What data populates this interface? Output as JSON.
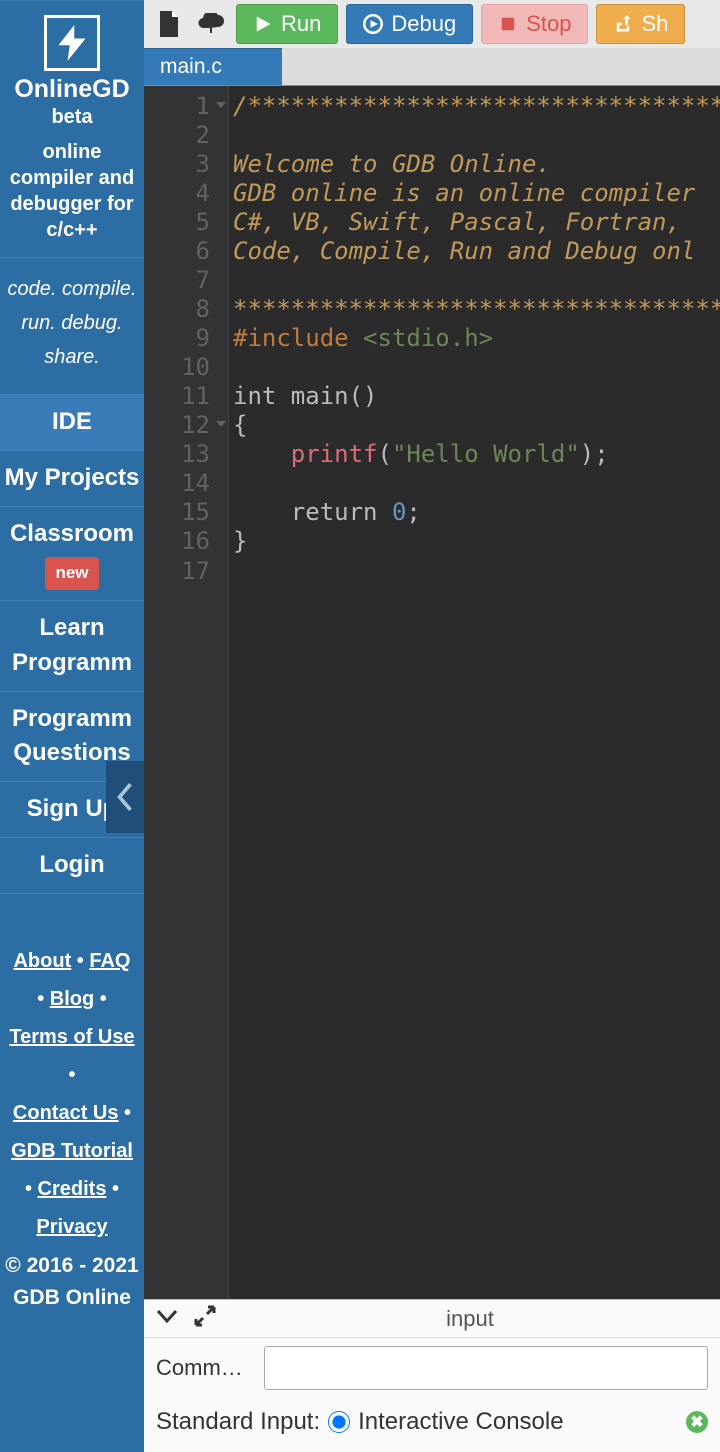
{
  "sidebar": {
    "brand": "OnlineGD",
    "beta": "beta",
    "tagline": "online compiler and debugger for c/c++",
    "motto": "code. compile. run. debug. share.",
    "nav": [
      {
        "label": "IDE",
        "active": true
      },
      {
        "label": "My Projects"
      },
      {
        "label": "Classroom",
        "badge": "new"
      },
      {
        "label": "Learn Programm"
      },
      {
        "label": "Programm Questions"
      },
      {
        "label": "Sign Up"
      },
      {
        "label": "Login"
      }
    ],
    "footer_links": [
      "About",
      "FAQ",
      "Blog",
      "Terms of Use",
      "Contact Us",
      "GDB Tutorial",
      "Credits",
      "Privacy"
    ],
    "copyright": "© 2016 - 2021 GDB Online"
  },
  "toolbar": {
    "run": "Run",
    "debug": "Debug",
    "stop": "Stop",
    "share": "Sh"
  },
  "tabs": {
    "active": "main.c"
  },
  "code_lines_count": 17,
  "code": {
    "l1": "/************************************",
    "l3": "Welcome to GDB Online.",
    "l4": "GDB online is an online compiler",
    "l5": "C#, VB, Swift, Pascal, Fortran,",
    "l6": "Code, Compile, Run and Debug onl",
    "l8": "************************************",
    "l9a": "#include ",
    "l9b": "<stdio.h>",
    "l11": "int main()",
    "l12": "{",
    "l13a": "    ",
    "l13fn": "printf",
    "l13p1": "(",
    "l13s": "\"Hello World\"",
    "l13p2": ");",
    "l15a": "    return ",
    "l15n": "0",
    "l15b": ";",
    "l16": "}"
  },
  "console": {
    "title": "input",
    "cmd_label": "Comm…",
    "stdin_label": "Standard Input:",
    "stdin_opt1": "Interactive Console"
  }
}
